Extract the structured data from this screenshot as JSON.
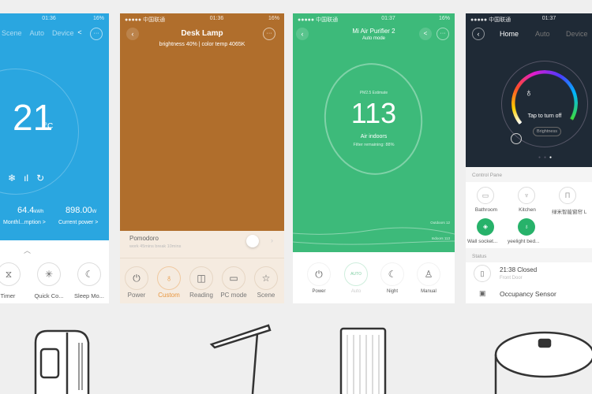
{
  "ac": {
    "time": "01:36",
    "tabs": [
      "Scene",
      "Auto",
      "Device"
    ],
    "temp": "21",
    "unit": "°C",
    "energy_value": "64.4",
    "energy_unit": "kWh",
    "energy_label": "Monthl...mption >",
    "power_value": "898.00",
    "power_unit": "W",
    "power_label": "Current power >",
    "buttons": [
      "Timer",
      "Quick Co...",
      "Sleep Mo..."
    ],
    "color": "#2aa6e0"
  },
  "lamp": {
    "carrier": "●●●●● 中国联通",
    "time": "01:36",
    "battery": "16%",
    "title": "Desk Lamp",
    "subtitle": "brightness 40% | color temp 4065K",
    "pomodoro_title": "Pomodoro",
    "pomodoro_sub": "work 45mins  break 10mins",
    "buttons": [
      "Power",
      "Custom",
      "Reading",
      "PC mode",
      "Scene"
    ],
    "active": "Custom",
    "color": "#b06e2c"
  },
  "purifier": {
    "carrier": "●●●●● 中国联通",
    "time": "01:37",
    "battery": "16%",
    "title": "Mi Air Purifier 2",
    "subtitle": "Auto mode",
    "pm_label": "PM2.5 Estimate",
    "value": "113",
    "air_label": "Air indoors",
    "filter": "Filter remaining: 88%",
    "outdoor": "Outdoors 12",
    "indoor": "Indoors 113",
    "buttons": [
      "Power",
      "Auto",
      "Night",
      "Manual"
    ],
    "auto_badge": "AUTO",
    "color": "#3dba7a"
  },
  "gateway": {
    "carrier": "●●●●● 中国联通",
    "time": "01:37",
    "tabs": [
      "Home",
      "Auto",
      "Device"
    ],
    "tap": "Tap to turn off",
    "brightness": "Brightness",
    "control_pane": "Control Pane",
    "items": [
      "Bathroom",
      "Kitchen",
      "绿米智能窗帘 L",
      "Wall socket...",
      "yeelight bed..."
    ],
    "status": "Status",
    "status_time": "21:38 Closed",
    "status_sub": "Front Door",
    "sensor": "Occupancy Sensor",
    "color": "#1f2a36"
  }
}
